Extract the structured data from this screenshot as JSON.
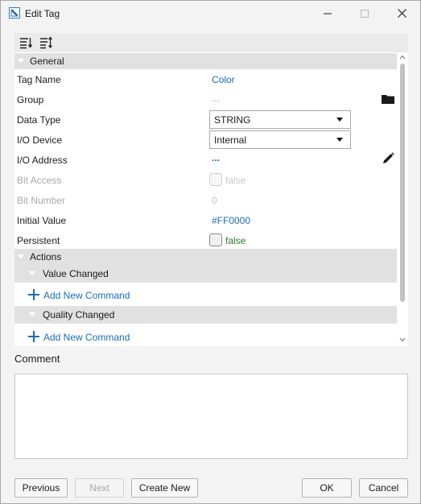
{
  "window": {
    "title": "Edit Tag"
  },
  "toolbar": {
    "sort_categorized_icon": "sort-categorized-icon",
    "sort_alpha_icon": "sort-alpha-icon"
  },
  "grid": {
    "general_label": "General",
    "rows": {
      "tag_name": {
        "label": "Tag Name",
        "value": "Color"
      },
      "group": {
        "label": "Group",
        "value": "..."
      },
      "data_type": {
        "label": "Data Type",
        "value": "STRING"
      },
      "io_device": {
        "label": "I/O Device",
        "value": "Internal"
      },
      "io_address": {
        "label": "I/O Address",
        "value": "..."
      },
      "bit_access": {
        "label": "Bit Access",
        "value": "false"
      },
      "bit_number": {
        "label": "Bit Number",
        "value": "0"
      },
      "initial_value": {
        "label": "Initial Value",
        "value": "#FF0000"
      },
      "persistent": {
        "label": "Persistent",
        "value": "false"
      }
    },
    "actions_label": "Actions",
    "value_changed_label": "Value Changed",
    "quality_changed_label": "Quality Changed",
    "add_command_label": "Add New Command"
  },
  "comment": {
    "label": "Comment",
    "value": ""
  },
  "buttons": {
    "previous": "Previous",
    "next": "Next",
    "create_new": "Create New",
    "ok": "OK",
    "cancel": "Cancel"
  }
}
